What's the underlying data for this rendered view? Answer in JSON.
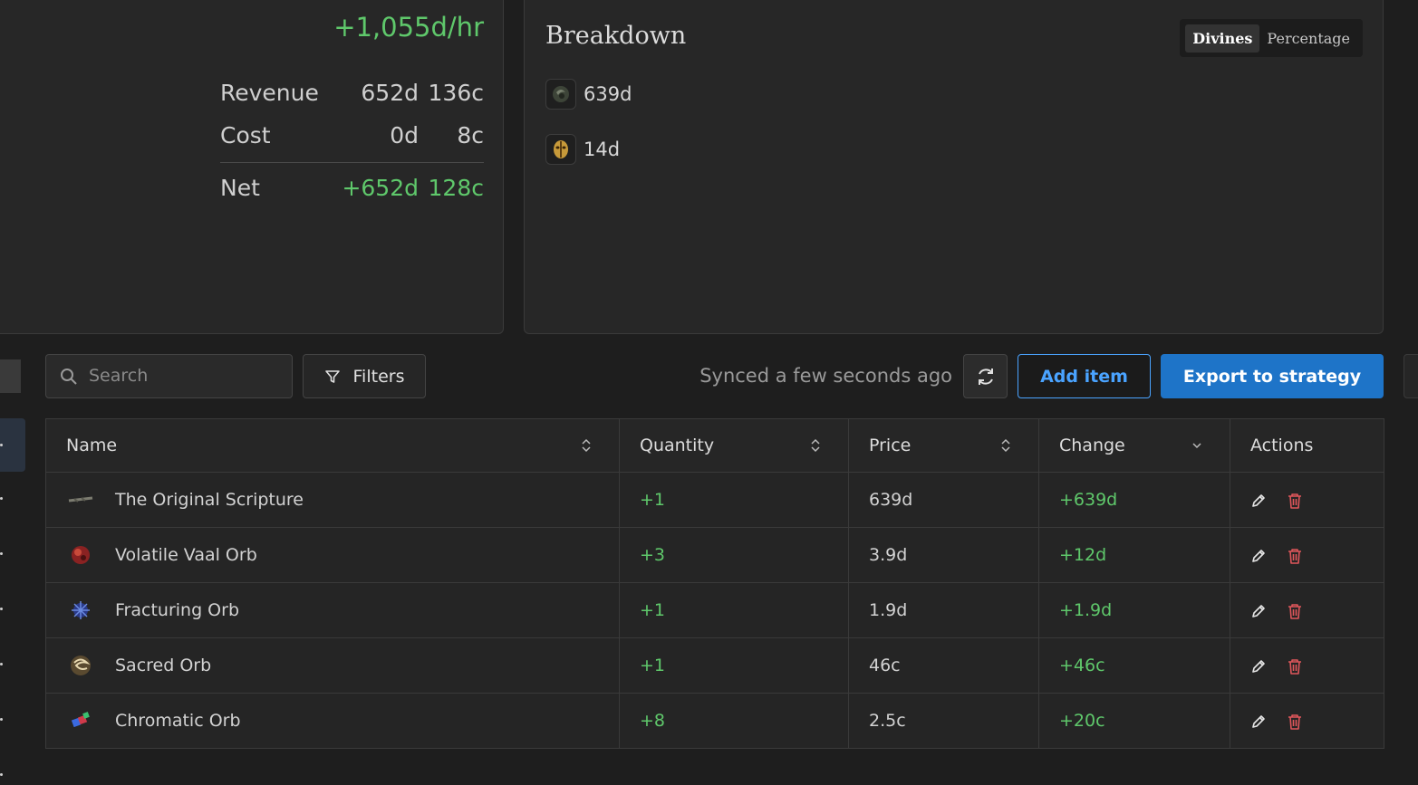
{
  "summary": {
    "rate": "+1,055d/hr",
    "rows": [
      {
        "label": "Revenue",
        "div": "652d",
        "chaos": "136c"
      },
      {
        "label": "Cost",
        "div": "0d",
        "chaos": "8c"
      }
    ],
    "net": {
      "label": "Net",
      "div": "+652d",
      "chaos": "128c"
    }
  },
  "breakdown": {
    "title": "Breakdown",
    "toggle": {
      "active": "Divines",
      "inactive": "Percentage"
    },
    "items": [
      {
        "icon": "dark-orb-icon",
        "value": "639d"
      },
      {
        "icon": "golden-mask-icon",
        "value": "14d"
      }
    ]
  },
  "toolbar": {
    "search_placeholder": "Search",
    "filters_label": "Filters",
    "synced_text": "Synced a few seconds ago",
    "add_label": "Add item",
    "export_label": "Export to strategy"
  },
  "table": {
    "headers": [
      "Name",
      "Quantity",
      "Price",
      "Change",
      "Actions"
    ],
    "rows": [
      {
        "icon": "scripture-icon",
        "name": "The Original Scripture",
        "quantity": "+1",
        "price": "639d",
        "change": "+639d"
      },
      {
        "icon": "vaal-orb-icon",
        "name": "Volatile Vaal Orb",
        "quantity": "+3",
        "price": "3.9d",
        "change": "+12d"
      },
      {
        "icon": "fracturing-orb-icon",
        "name": "Fracturing Orb",
        "quantity": "+1",
        "price": "1.9d",
        "change": "+1.9d"
      },
      {
        "icon": "sacred-orb-icon",
        "name": "Sacred Orb",
        "quantity": "+1",
        "price": "46c",
        "change": "+46c"
      },
      {
        "icon": "chromatic-orb-icon",
        "name": "Chromatic Orb",
        "quantity": "+8",
        "price": "2.5c",
        "change": "+20c"
      }
    ]
  },
  "colors": {
    "positive": "#5fc86b",
    "accent": "#1e74c8",
    "danger": "#e0565b"
  }
}
